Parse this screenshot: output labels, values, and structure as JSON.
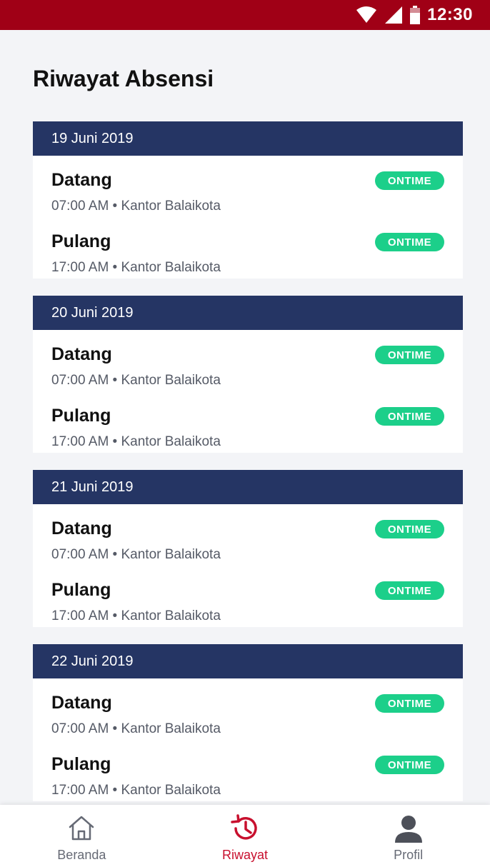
{
  "status_bar": {
    "time": "12:30"
  },
  "page": {
    "title": "Riwayat Absensi"
  },
  "days": [
    {
      "date": "19 Juni 2019",
      "entries": [
        {
          "label": "Datang",
          "detail": "07:00 AM • Kantor Balaikota",
          "status": "ONTIME"
        },
        {
          "label": "Pulang",
          "detail": "17:00 AM • Kantor Balaikota",
          "status": "ONTIME"
        }
      ]
    },
    {
      "date": "20 Juni 2019",
      "entries": [
        {
          "label": "Datang",
          "detail": "07:00 AM • Kantor Balaikota",
          "status": "ONTIME"
        },
        {
          "label": "Pulang",
          "detail": "17:00 AM • Kantor Balaikota",
          "status": "ONTIME"
        }
      ]
    },
    {
      "date": "21 Juni 2019",
      "entries": [
        {
          "label": "Datang",
          "detail": "07:00 AM • Kantor Balaikota",
          "status": "ONTIME"
        },
        {
          "label": "Pulang",
          "detail": "17:00 AM • Kantor Balaikota",
          "status": "ONTIME"
        }
      ]
    },
    {
      "date": "22 Juni 2019",
      "entries": [
        {
          "label": "Datang",
          "detail": "07:00 AM • Kantor Balaikota",
          "status": "ONTIME"
        },
        {
          "label": "Pulang",
          "detail": "17:00 AM • Kantor Balaikota",
          "status": "ONTIME"
        }
      ]
    }
  ],
  "bottom_nav": {
    "items": [
      {
        "label": "Beranda",
        "icon": "home-icon",
        "active": false
      },
      {
        "label": "Riwayat",
        "icon": "history-icon",
        "active": true
      },
      {
        "label": "Profil",
        "icon": "profile-icon",
        "active": false
      }
    ]
  },
  "colors": {
    "status_bar": "#a00016",
    "day_header": "#253564",
    "badge": "#1ccf8a",
    "active_nav": "#c8102e"
  }
}
